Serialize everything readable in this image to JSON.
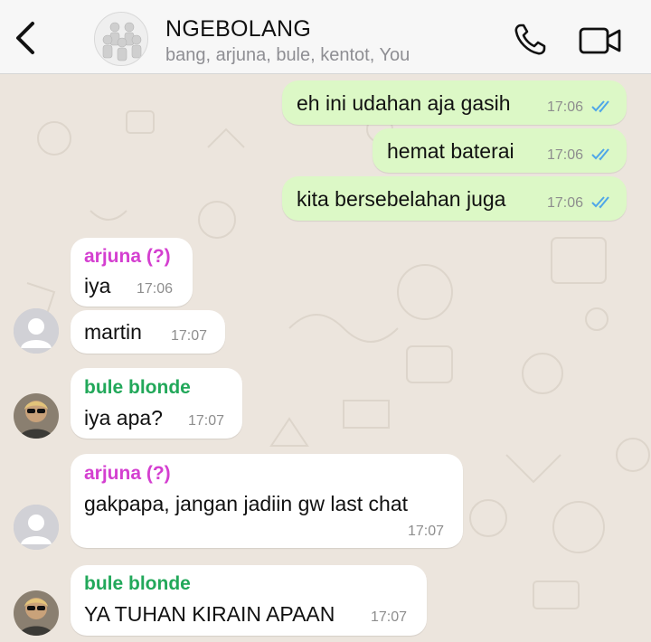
{
  "header": {
    "title": "NGEBOLANG",
    "members": "bang, arjuna, bule, kentot, You",
    "icons": {
      "back": "chevron-left-icon",
      "call": "phone-icon",
      "video": "video-camera-icon"
    }
  },
  "colors": {
    "outgoing_bubble": "#dcf8c6",
    "incoming_bubble": "#ffffff",
    "read_ticks": "#4fa6e8",
    "sender_arjuna": "#d43fd0",
    "sender_bule": "#22a85a",
    "background": "#ece5dd"
  },
  "messages": [
    {
      "direction": "out",
      "text": "eh ini udahan aja gasih",
      "time": "17:06",
      "status": "read"
    },
    {
      "direction": "out",
      "text": "hemat baterai",
      "time": "17:06",
      "status": "read"
    },
    {
      "direction": "out",
      "text": "kita bersebelahan juga",
      "time": "17:06",
      "status": "read"
    },
    {
      "direction": "in",
      "sender": "arjuna (?)",
      "text": "iya",
      "time": "17:06"
    },
    {
      "direction": "in",
      "text": "martin",
      "time": "17:07"
    },
    {
      "direction": "in",
      "sender": "bule blonde",
      "text": "iya apa?",
      "time": "17:07"
    },
    {
      "direction": "in",
      "sender": "arjuna (?)",
      "text": "gakpapa, jangan jadiin gw last chat",
      "time": "17:07"
    },
    {
      "direction": "in",
      "sender": "bule blonde",
      "text": "YA TUHAN KIRAIN APAAN",
      "time": "17:07"
    }
  ]
}
